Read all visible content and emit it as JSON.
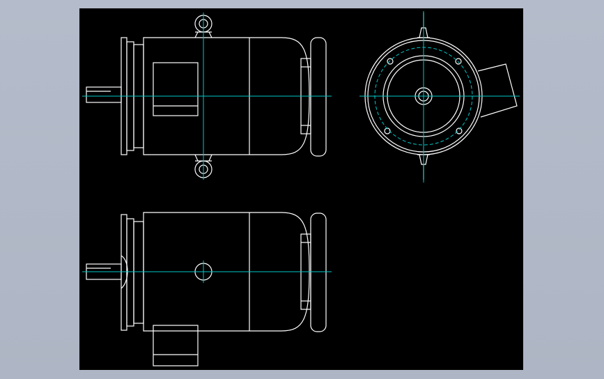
{
  "app": {
    "background": "#b0b7c6"
  },
  "drawing": {
    "background": "#000000",
    "line_color": "#ffffff",
    "centerline_color": "#00c8c8",
    "views": [
      "front-view",
      "end-view",
      "bottom-view"
    ]
  }
}
